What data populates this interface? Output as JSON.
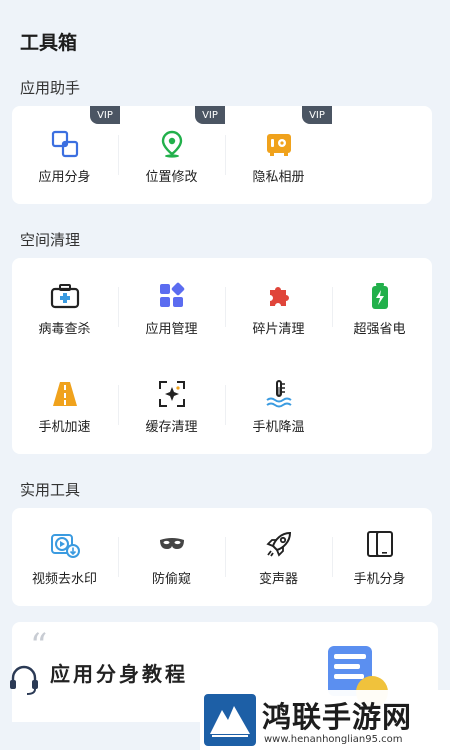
{
  "page_title": "工具箱",
  "sections": {
    "assistant": {
      "title": "应用助手",
      "items": [
        {
          "label": "应用分身",
          "badge": "VIP",
          "icon": "clone-icon"
        },
        {
          "label": "位置修改",
          "badge": "VIP",
          "icon": "location-pin-icon"
        },
        {
          "label": "隐私相册",
          "badge": "VIP",
          "icon": "safe-icon"
        }
      ]
    },
    "cleanup": {
      "title": "空间清理",
      "items": [
        {
          "label": "病毒查杀",
          "icon": "first-aid-kit-icon"
        },
        {
          "label": "应用管理",
          "icon": "app-grid-icon"
        },
        {
          "label": "碎片清理",
          "icon": "puzzle-icon"
        },
        {
          "label": "超强省电",
          "icon": "battery-icon"
        },
        {
          "label": "手机加速",
          "icon": "road-icon"
        },
        {
          "label": "缓存清理",
          "icon": "sparkle-icon"
        },
        {
          "label": "手机降温",
          "icon": "thermometer-icon"
        }
      ]
    },
    "utilities": {
      "title": "实用工具",
      "items": [
        {
          "label": "视频去水印",
          "icon": "video-download-icon"
        },
        {
          "label": "防偷窥",
          "icon": "mask-icon"
        },
        {
          "label": "变声器",
          "icon": "rocket-icon"
        },
        {
          "label": "手机分身",
          "icon": "dual-phone-icon"
        }
      ]
    }
  },
  "banner": {
    "quote_mark": "“",
    "title": "应用分身教程"
  },
  "watermark": {
    "title": "鸿联手游网",
    "url": "www.henanhonglian95.com"
  },
  "colors": {
    "accent_blue": "#3b6fe0",
    "accent_green": "#22b04b",
    "accent_red": "#e0453a",
    "accent_orange": "#f0a21c",
    "vip_badge": "#4b5563",
    "background": "#eef3f9"
  }
}
